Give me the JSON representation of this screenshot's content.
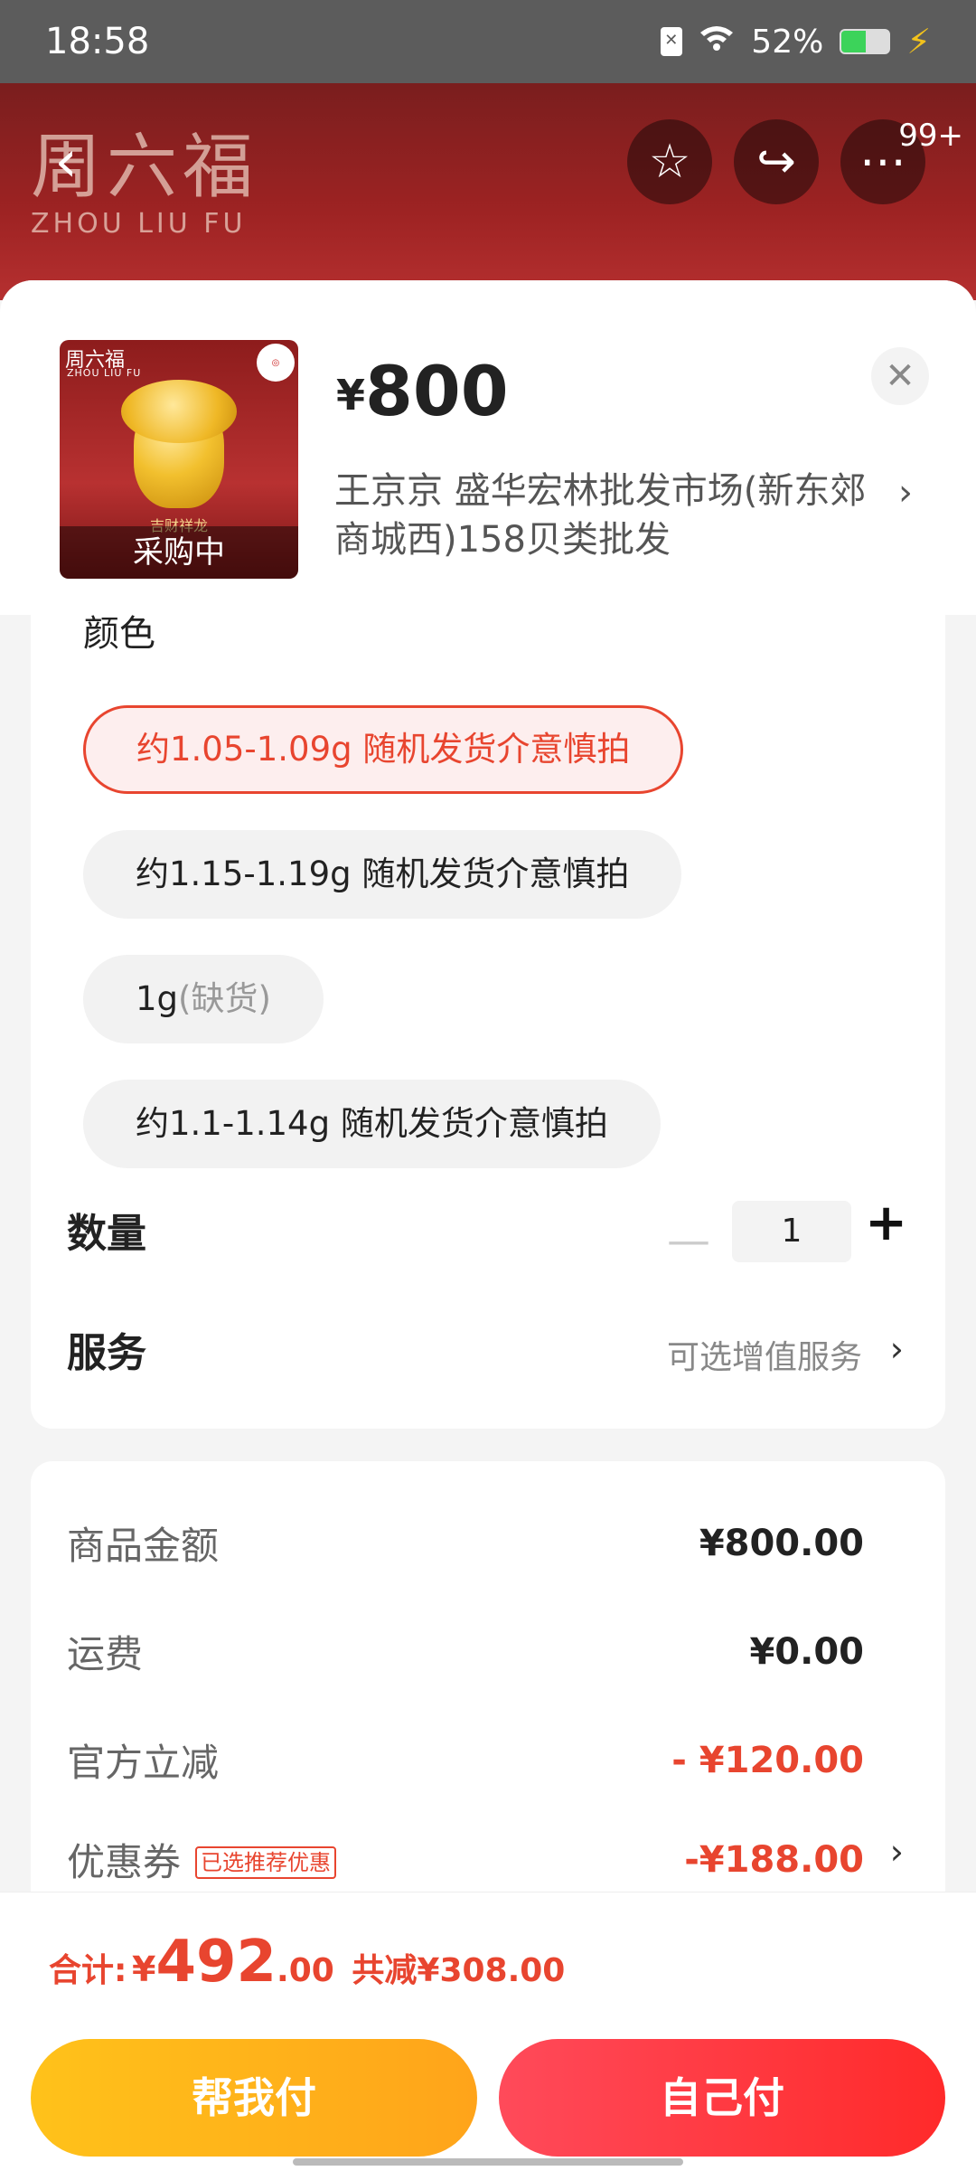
{
  "status_bar": {
    "time": "18:58",
    "battery": "52%"
  },
  "header": {
    "brand_cn": "周六福",
    "brand_en": "ZHOU LIU FU",
    "cart_badge": "99+"
  },
  "product": {
    "thumb_brand": "周六福",
    "thumb_brand_en": "ZHOU LIU FU",
    "thumb_caption": "吉财祥龙",
    "thumb_status": "采购中",
    "currency": "¥",
    "price": "800",
    "shop": "王京京  盛华宏林批发市场(新东郊商城西)158贝类批发"
  },
  "spec": {
    "title": "颜色",
    "options": [
      {
        "label": "约1.05-1.09g 随机发货介意慎拍",
        "sub": ""
      },
      {
        "label": "约1.15-1.19g 随机发货介意慎拍",
        "sub": ""
      },
      {
        "label": "1g",
        "sub": "(缺货)"
      },
      {
        "label": "约1.1-1.14g 随机发货介意慎拍",
        "sub": ""
      }
    ],
    "quantity_label": "数量",
    "quantity_value": "1",
    "service_label": "服务",
    "service_hint": "可选增值服务"
  },
  "summary": {
    "goods_label": "商品金额",
    "goods_value": "¥800.00",
    "shipping_label": "运费",
    "shipping_value": "¥0.00",
    "discount_label": "官方立减",
    "discount_value": "- ¥120.00",
    "coupon_label": "优惠券",
    "coupon_tag": "已选推荐优惠",
    "coupon_value": "-¥188.00"
  },
  "footer": {
    "total_label": "合计:",
    "total_currency": "¥",
    "total_int": "492",
    "total_dec": ".00",
    "total_saved": "共减¥308.00",
    "help_pay_label": "帮我付",
    "self_pay_label": "自己付"
  },
  "colors": {
    "accent": "#e8452f",
    "help_pay": "#ffb31a",
    "self_pay": "#ff3a40"
  }
}
